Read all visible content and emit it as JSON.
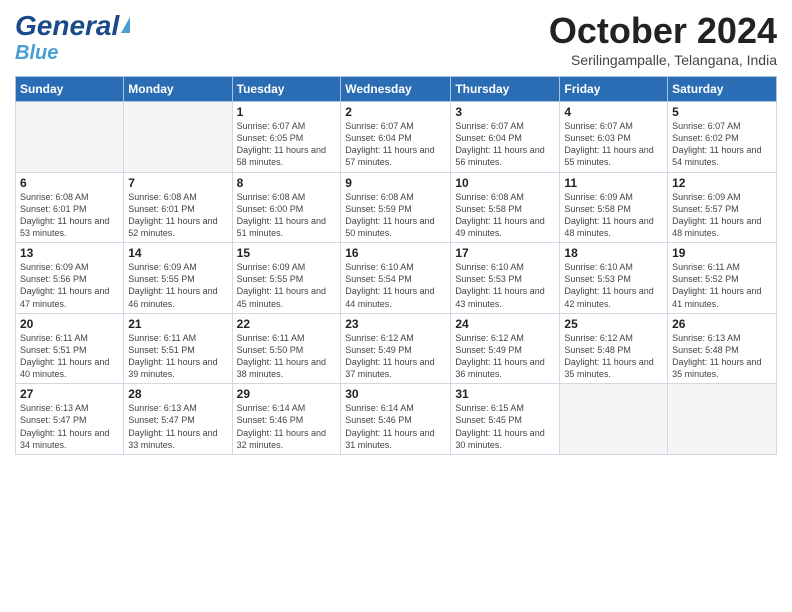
{
  "header": {
    "logo_line1": "General",
    "logo_line2": "Blue",
    "month_title": "October 2024",
    "subtitle": "Serilingampalle, Telangana, India"
  },
  "days_of_week": [
    "Sunday",
    "Monday",
    "Tuesday",
    "Wednesday",
    "Thursday",
    "Friday",
    "Saturday"
  ],
  "weeks": [
    [
      {
        "day": "",
        "empty": true
      },
      {
        "day": "",
        "empty": true
      },
      {
        "day": "1",
        "sunrise": "6:07 AM",
        "sunset": "6:05 PM",
        "daylight": "11 hours and 58 minutes."
      },
      {
        "day": "2",
        "sunrise": "6:07 AM",
        "sunset": "6:04 PM",
        "daylight": "11 hours and 57 minutes."
      },
      {
        "day": "3",
        "sunrise": "6:07 AM",
        "sunset": "6:04 PM",
        "daylight": "11 hours and 56 minutes."
      },
      {
        "day": "4",
        "sunrise": "6:07 AM",
        "sunset": "6:03 PM",
        "daylight": "11 hours and 55 minutes."
      },
      {
        "day": "5",
        "sunrise": "6:07 AM",
        "sunset": "6:02 PM",
        "daylight": "11 hours and 54 minutes."
      }
    ],
    [
      {
        "day": "6",
        "sunrise": "6:08 AM",
        "sunset": "6:01 PM",
        "daylight": "11 hours and 53 minutes."
      },
      {
        "day": "7",
        "sunrise": "6:08 AM",
        "sunset": "6:01 PM",
        "daylight": "11 hours and 52 minutes."
      },
      {
        "day": "8",
        "sunrise": "6:08 AM",
        "sunset": "6:00 PM",
        "daylight": "11 hours and 51 minutes."
      },
      {
        "day": "9",
        "sunrise": "6:08 AM",
        "sunset": "5:59 PM",
        "daylight": "11 hours and 50 minutes."
      },
      {
        "day": "10",
        "sunrise": "6:08 AM",
        "sunset": "5:58 PM",
        "daylight": "11 hours and 49 minutes."
      },
      {
        "day": "11",
        "sunrise": "6:09 AM",
        "sunset": "5:58 PM",
        "daylight": "11 hours and 48 minutes."
      },
      {
        "day": "12",
        "sunrise": "6:09 AM",
        "sunset": "5:57 PM",
        "daylight": "11 hours and 48 minutes."
      }
    ],
    [
      {
        "day": "13",
        "sunrise": "6:09 AM",
        "sunset": "5:56 PM",
        "daylight": "11 hours and 47 minutes."
      },
      {
        "day": "14",
        "sunrise": "6:09 AM",
        "sunset": "5:55 PM",
        "daylight": "11 hours and 46 minutes."
      },
      {
        "day": "15",
        "sunrise": "6:09 AM",
        "sunset": "5:55 PM",
        "daylight": "11 hours and 45 minutes."
      },
      {
        "day": "16",
        "sunrise": "6:10 AM",
        "sunset": "5:54 PM",
        "daylight": "11 hours and 44 minutes."
      },
      {
        "day": "17",
        "sunrise": "6:10 AM",
        "sunset": "5:53 PM",
        "daylight": "11 hours and 43 minutes."
      },
      {
        "day": "18",
        "sunrise": "6:10 AM",
        "sunset": "5:53 PM",
        "daylight": "11 hours and 42 minutes."
      },
      {
        "day": "19",
        "sunrise": "6:11 AM",
        "sunset": "5:52 PM",
        "daylight": "11 hours and 41 minutes."
      }
    ],
    [
      {
        "day": "20",
        "sunrise": "6:11 AM",
        "sunset": "5:51 PM",
        "daylight": "11 hours and 40 minutes."
      },
      {
        "day": "21",
        "sunrise": "6:11 AM",
        "sunset": "5:51 PM",
        "daylight": "11 hours and 39 minutes."
      },
      {
        "day": "22",
        "sunrise": "6:11 AM",
        "sunset": "5:50 PM",
        "daylight": "11 hours and 38 minutes."
      },
      {
        "day": "23",
        "sunrise": "6:12 AM",
        "sunset": "5:49 PM",
        "daylight": "11 hours and 37 minutes."
      },
      {
        "day": "24",
        "sunrise": "6:12 AM",
        "sunset": "5:49 PM",
        "daylight": "11 hours and 36 minutes."
      },
      {
        "day": "25",
        "sunrise": "6:12 AM",
        "sunset": "5:48 PM",
        "daylight": "11 hours and 35 minutes."
      },
      {
        "day": "26",
        "sunrise": "6:13 AM",
        "sunset": "5:48 PM",
        "daylight": "11 hours and 35 minutes."
      }
    ],
    [
      {
        "day": "27",
        "sunrise": "6:13 AM",
        "sunset": "5:47 PM",
        "daylight": "11 hours and 34 minutes."
      },
      {
        "day": "28",
        "sunrise": "6:13 AM",
        "sunset": "5:47 PM",
        "daylight": "11 hours and 33 minutes."
      },
      {
        "day": "29",
        "sunrise": "6:14 AM",
        "sunset": "5:46 PM",
        "daylight": "11 hours and 32 minutes."
      },
      {
        "day": "30",
        "sunrise": "6:14 AM",
        "sunset": "5:46 PM",
        "daylight": "11 hours and 31 minutes."
      },
      {
        "day": "31",
        "sunrise": "6:15 AM",
        "sunset": "5:45 PM",
        "daylight": "11 hours and 30 minutes."
      },
      {
        "day": "",
        "empty": true
      },
      {
        "day": "",
        "empty": true
      }
    ]
  ]
}
